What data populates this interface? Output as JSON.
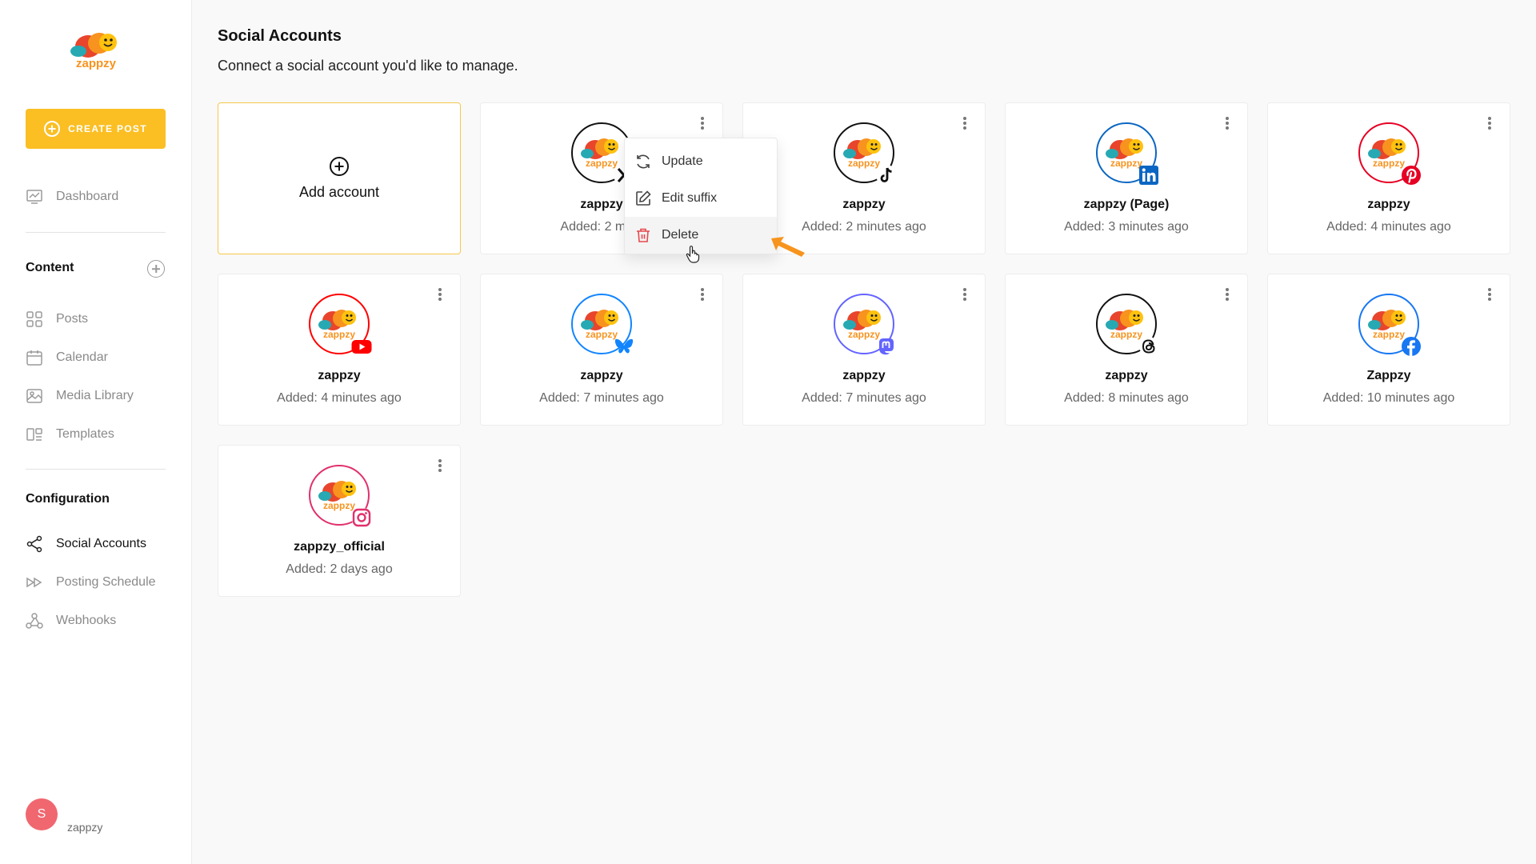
{
  "sidebar": {
    "logo_text": "zappzy",
    "create_label": "CREATE POST",
    "dashboard_label": "Dashboard",
    "content_title": "Content",
    "content_items": [
      "Posts",
      "Calendar",
      "Media Library",
      "Templates"
    ],
    "config_title": "Configuration",
    "config_items": [
      "Social Accounts",
      "Posting Schedule",
      "Webhooks"
    ],
    "user": {
      "initial": "S",
      "name": "zappzy"
    }
  },
  "page": {
    "title": "Social Accounts",
    "subtitle": "Connect a social account you'd like to manage."
  },
  "add_card": {
    "label": "Add account"
  },
  "accounts": [
    {
      "name": "zappzy",
      "added": "Added: 2 minutes ago",
      "platform": "x",
      "ring": "#111111"
    },
    {
      "name": "zappzy",
      "added": "Added: 2 minutes ago",
      "platform": "tiktok",
      "ring": "#111111"
    },
    {
      "name": "zappzy (Page)",
      "added": "Added: 3 minutes ago",
      "platform": "linkedin",
      "ring": "#0a66c2"
    },
    {
      "name": "zappzy",
      "added": "Added: 4 minutes ago",
      "platform": "pinterest",
      "ring": "#e60023"
    },
    {
      "name": "zappzy",
      "added": "Added: 4 minutes ago",
      "platform": "youtube",
      "ring": "#ff0000"
    },
    {
      "name": "zappzy",
      "added": "Added: 7 minutes ago",
      "platform": "bluesky",
      "ring": "#1185fe"
    },
    {
      "name": "zappzy",
      "added": "Added: 7 minutes ago",
      "platform": "mastodon",
      "ring": "#6364ff"
    },
    {
      "name": "zappzy",
      "added": "Added: 8 minutes ago",
      "platform": "threads",
      "ring": "#111111"
    },
    {
      "name": "Zappzy",
      "added": "Added: 10 minutes ago",
      "platform": "facebook",
      "ring": "#1877f2"
    },
    {
      "name": "zappzy_official",
      "added": "Added: 2 days ago",
      "platform": "instagram",
      "ring": "#e1306c"
    }
  ],
  "first_card_added_visible": "Added: 2 minu",
  "menu": {
    "update": "Update",
    "edit_suffix": "Edit suffix",
    "delete": "Delete"
  },
  "colors": {
    "accent": "#fbbf24",
    "annotation_arrow": "#f7941d",
    "delete_icon": "#e5484d"
  }
}
